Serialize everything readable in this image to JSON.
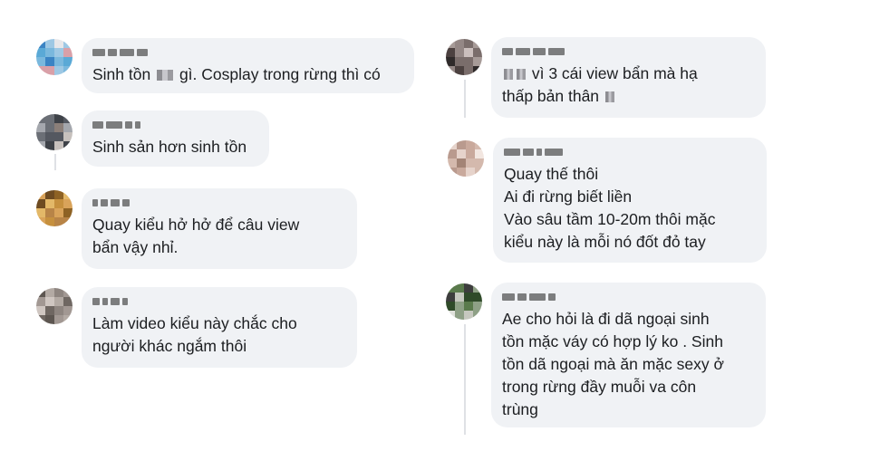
{
  "left_column": [
    {
      "lines": [
        "Sinh tồn ",
        " gì. Cosplay trong rừng thì có"
      ]
    },
    {
      "lines": [
        "Sinh sản hơn sinh tồn"
      ]
    },
    {
      "lines": [
        "Quay kiểu hở hở để câu view\nbẩn vậy nhỉ."
      ]
    },
    {
      "lines": [
        "Làm video kiểu này chắc cho\nngười khác ngắm thôi"
      ]
    }
  ],
  "right_column": [
    {
      "lines": [
        " vì 3 cái view bẩn mà hạ\nthấp bản thân "
      ]
    },
    {
      "lines": [
        "Quay thế thôi\nAi đi rừng biết liền\nVào sâu tầm 10-20m thôi mặc\nkiểu này là mỗi nó đốt đỏ tay"
      ]
    },
    {
      "lines": [
        "Ae cho hỏi là đi dã ngoại sinh\ntồn mặc váy có hợp lý ko . Sinh\ntồn dã ngoại mà ăn mặc sexy ở\ntrong rừng đầy muỗi va côn\ntrùng"
      ]
    }
  ],
  "avatar_palettes": [
    [
      "#5aa9d6",
      "#3b84c4",
      "#9ec8e4",
      "#e7e7ea",
      "#d9a0a8",
      "#7ab8dd"
    ],
    [
      "#6b6f76",
      "#a4a7ad",
      "#3e4248",
      "#c7c1bd",
      "#8b7f79",
      "#545860"
    ],
    [
      "#c6903e",
      "#8e6224",
      "#e3b868",
      "#6e4b21",
      "#b88447",
      "#d9a35a"
    ],
    [
      "#8e8580",
      "#b3aaa4",
      "#6f6762",
      "#cfc6c1",
      "#5d5651",
      "#a29893"
    ],
    [
      "#7a6d6b",
      "#4c4140",
      "#a79b98",
      "#cbbfbd",
      "#2f2a2a",
      "#948785"
    ],
    [
      "#d4b9ad",
      "#e6d3cb",
      "#b99a8e",
      "#f2e6e0",
      "#a38476",
      "#c9a99c"
    ],
    [
      "#5a7a4c",
      "#2f4a29",
      "#c6c8bf",
      "#8ea086",
      "#3d3d3d",
      "#e0e2dc"
    ]
  ]
}
